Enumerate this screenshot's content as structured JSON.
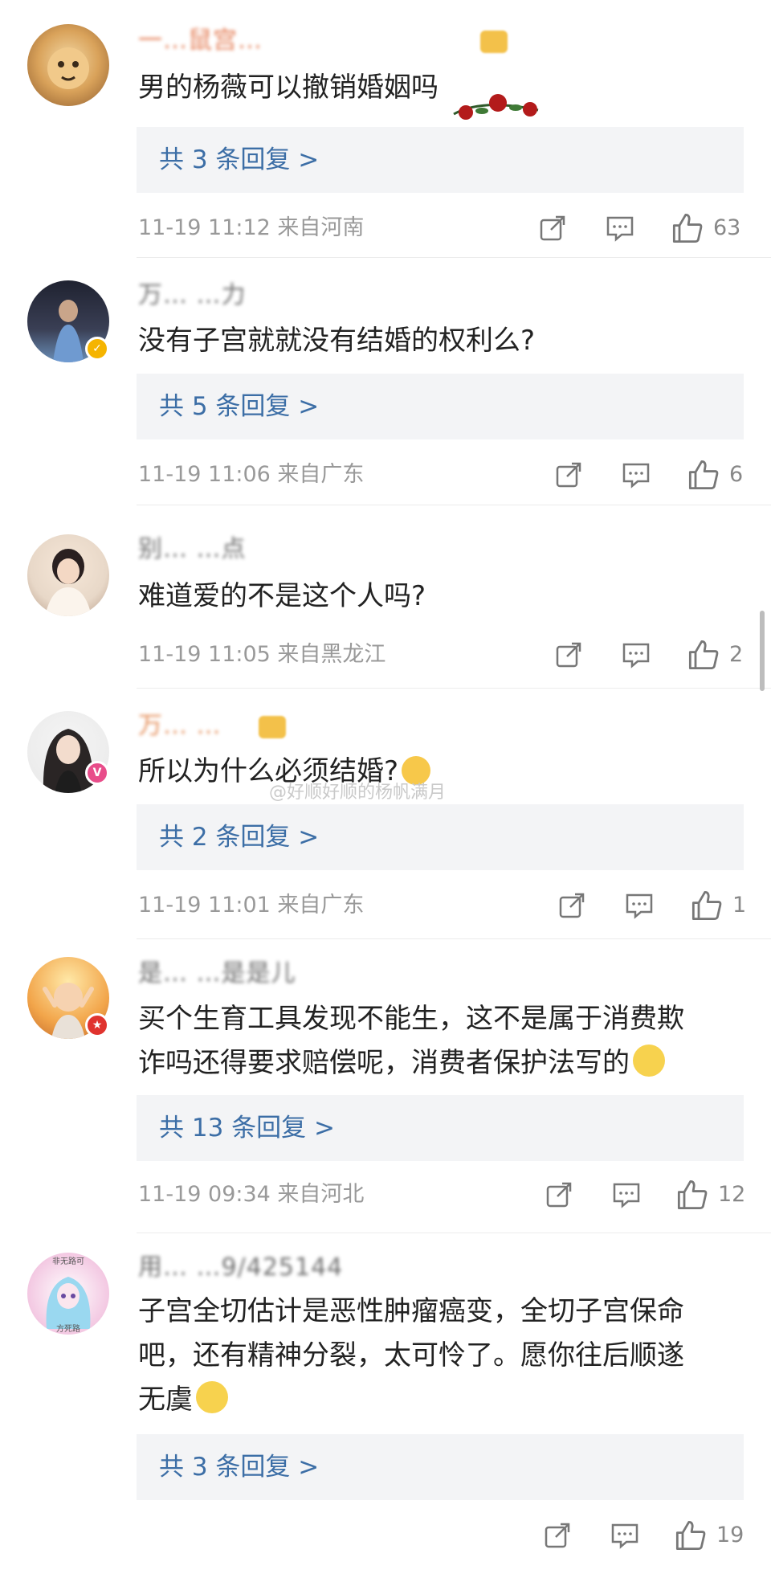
{
  "watermark": "@好顺好顺的杨帆满月",
  "comments": [
    {
      "username": "一…鼠宫…",
      "content": "男的杨薇可以撤销婚姻吗",
      "replies": "共 3 条回复 >",
      "meta": "11-19 11:12  来自河南",
      "likes": "63",
      "avatar_color": "#d9a25a"
    },
    {
      "username": "万… …力",
      "content": "没有子宫就就没有结婚的权利么?",
      "replies": "共 5 条回复 >",
      "meta": "11-19 11:06  来自广东",
      "likes": "6",
      "avatar_color": "#2e3240"
    },
    {
      "username": "别… …点",
      "content": "难道爱的不是这个人吗?",
      "meta": "11-19 11:05  来自黑龙江",
      "likes": "2",
      "avatar_color": "#e8d8c8"
    },
    {
      "username": "万… …",
      "content": "所以为什么必须结婚?",
      "replies": "共 2 条回复 >",
      "meta": "11-19 11:01  来自广东",
      "likes": "1",
      "avatar_color": "#3b3b3b"
    },
    {
      "username": "是… …是是儿",
      "content_lines": [
        "买个生育工具发现不能生，这不是属于消费欺",
        "诈吗还得要求赔偿呢，消费者保护法写的"
      ],
      "replies": "共 13 条回复 >",
      "meta": "11-19 09:34  来自河北",
      "likes": "12",
      "avatar_color": "#f2a54a"
    },
    {
      "username": "用… …9/425144",
      "content_lines": [
        "子宫全切估计是恶性肿瘤癌变，全切子宫保命",
        "吧，还有精神分裂，太可怜了。愿你往后顺遂",
        "无虞"
      ],
      "replies": "共 3 条回复 >",
      "likes": "19",
      "avatar_color": "#f3c8e2",
      "avatar_text": "非无路可 / 方死路"
    }
  ],
  "colors": {
    "reply_link": "#3c6ea6",
    "reply_bg": "#f3f4f6",
    "meta": "#999999",
    "badge_gold": "#f5b400",
    "badge_pink": "#e84d8a",
    "badge_red": "#e0332e"
  },
  "icons": [
    "share-icon",
    "comment-icon",
    "like-icon"
  ]
}
